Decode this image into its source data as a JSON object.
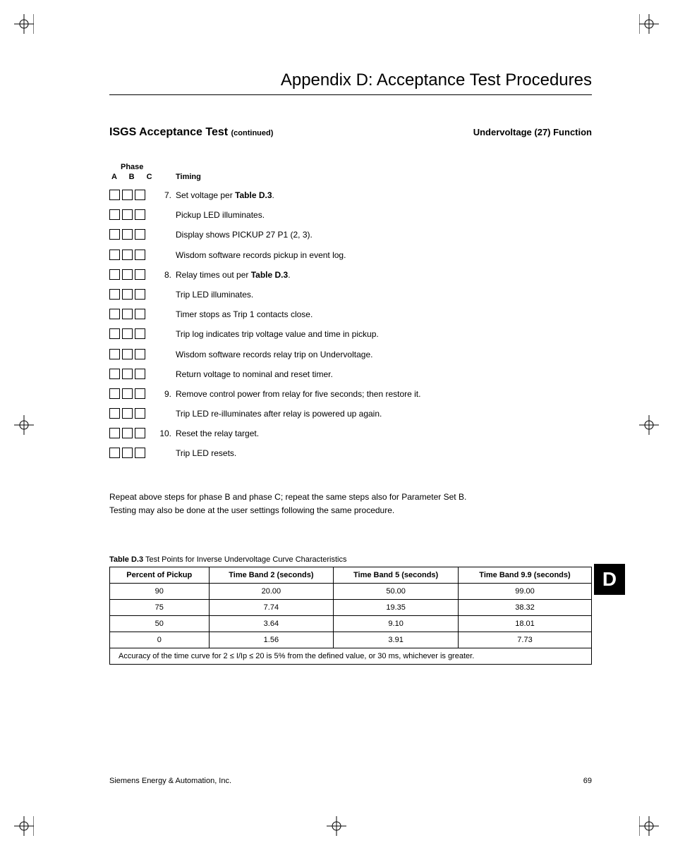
{
  "appendix_title": "Appendix D:  Acceptance Test Procedures",
  "section_title": "ISGS Acceptance Test",
  "section_cont": "(continued)",
  "function_title": "Undervoltage (27) Function",
  "phase_label": "Phase",
  "phase_abc": "A  B  C",
  "timing_label": "Timing",
  "steps": [
    {
      "num": "7.",
      "pre": "Set voltage per ",
      "bold": "Table D.3",
      "post": "."
    },
    {
      "num": "",
      "pre": "Pickup LED illuminates.",
      "bold": "",
      "post": ""
    },
    {
      "num": "",
      "pre": "Display shows PICKUP 27 P1 (2, 3).",
      "bold": "",
      "post": ""
    },
    {
      "num": "",
      "pre": "Wisdom software records pickup in event log.",
      "bold": "",
      "post": ""
    },
    {
      "num": "8.",
      "pre": "Relay times out per ",
      "bold": "Table D.3",
      "post": "."
    },
    {
      "num": "",
      "pre": "Trip LED illuminates.",
      "bold": "",
      "post": ""
    },
    {
      "num": "",
      "pre": "Timer stops as Trip 1 contacts close.",
      "bold": "",
      "post": ""
    },
    {
      "num": "",
      "pre": "Trip log indicates trip voltage value and time in pickup.",
      "bold": "",
      "post": ""
    },
    {
      "num": "",
      "pre": "Wisdom software records relay trip on Undervoltage.",
      "bold": "",
      "post": ""
    },
    {
      "num": "",
      "pre": "Return voltage to nominal and reset timer.",
      "bold": "",
      "post": ""
    },
    {
      "num": "9.",
      "pre": "Remove control power from relay for five seconds; then restore it.",
      "bold": "",
      "post": ""
    },
    {
      "num": "",
      "pre": "Trip LED re-illuminates after relay is powered up again.",
      "bold": "",
      "post": ""
    },
    {
      "num": "10.",
      "pre": "Reset the relay target.",
      "bold": "",
      "post": ""
    },
    {
      "num": "",
      "pre": "Trip LED resets.",
      "bold": "",
      "post": ""
    }
  ],
  "note_line1": "Repeat above steps for phase B and phase C; repeat the same steps also for Parameter Set B.",
  "note_line2": "Testing may also be done at the user settings following the same procedure.",
  "table_caption_bold": "Table D.3",
  "table_caption_rest": " Test Points for Inverse Undervoltage Curve Characteristics",
  "chart_data": {
    "type": "table",
    "headers": [
      "Percent of Pickup",
      "Time Band 2 (seconds)",
      "Time Band 5 (seconds)",
      "Time Band 9.9 (seconds)"
    ],
    "rows": [
      [
        "90",
        "20.00",
        "50.00",
        "99.00"
      ],
      [
        "75",
        "7.74",
        "19.35",
        "38.32"
      ],
      [
        "50",
        "3.64",
        "9.10",
        "18.01"
      ],
      [
        "0",
        "1.56",
        "3.91",
        "7.73"
      ]
    ],
    "accuracy_note": "Accuracy of the time curve for 2 ≤ I/Ip ≤ 20 is 5% from the defined value, or 30 ms, whichever is greater."
  },
  "side_tab": "D",
  "footer_left": "Siemens Energy & Automation, Inc.",
  "footer_right": "69"
}
